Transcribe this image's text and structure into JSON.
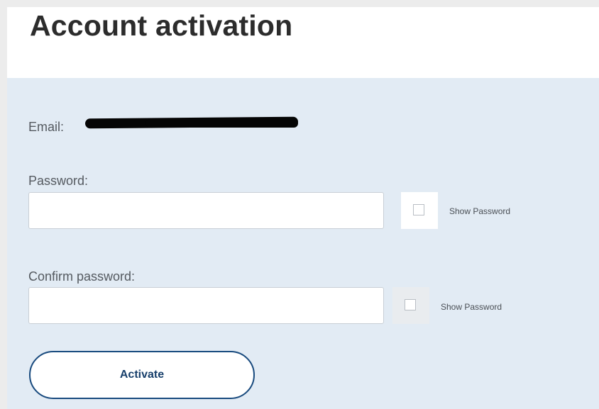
{
  "page": {
    "title": "Account activation"
  },
  "form": {
    "email_label": "Email:",
    "password_label": "Password:",
    "password_value": "",
    "show_password_label": "Show Password",
    "confirm_password_label": "Confirm password:",
    "confirm_password_value": "",
    "confirm_show_password_label": "Show Password",
    "show_password_checked": false,
    "confirm_show_password_checked": false,
    "activate_button_label": "Activate"
  },
  "colors": {
    "panel_background": "#e2ebf4",
    "button_border": "#184a7e",
    "button_text": "#173f6b"
  }
}
